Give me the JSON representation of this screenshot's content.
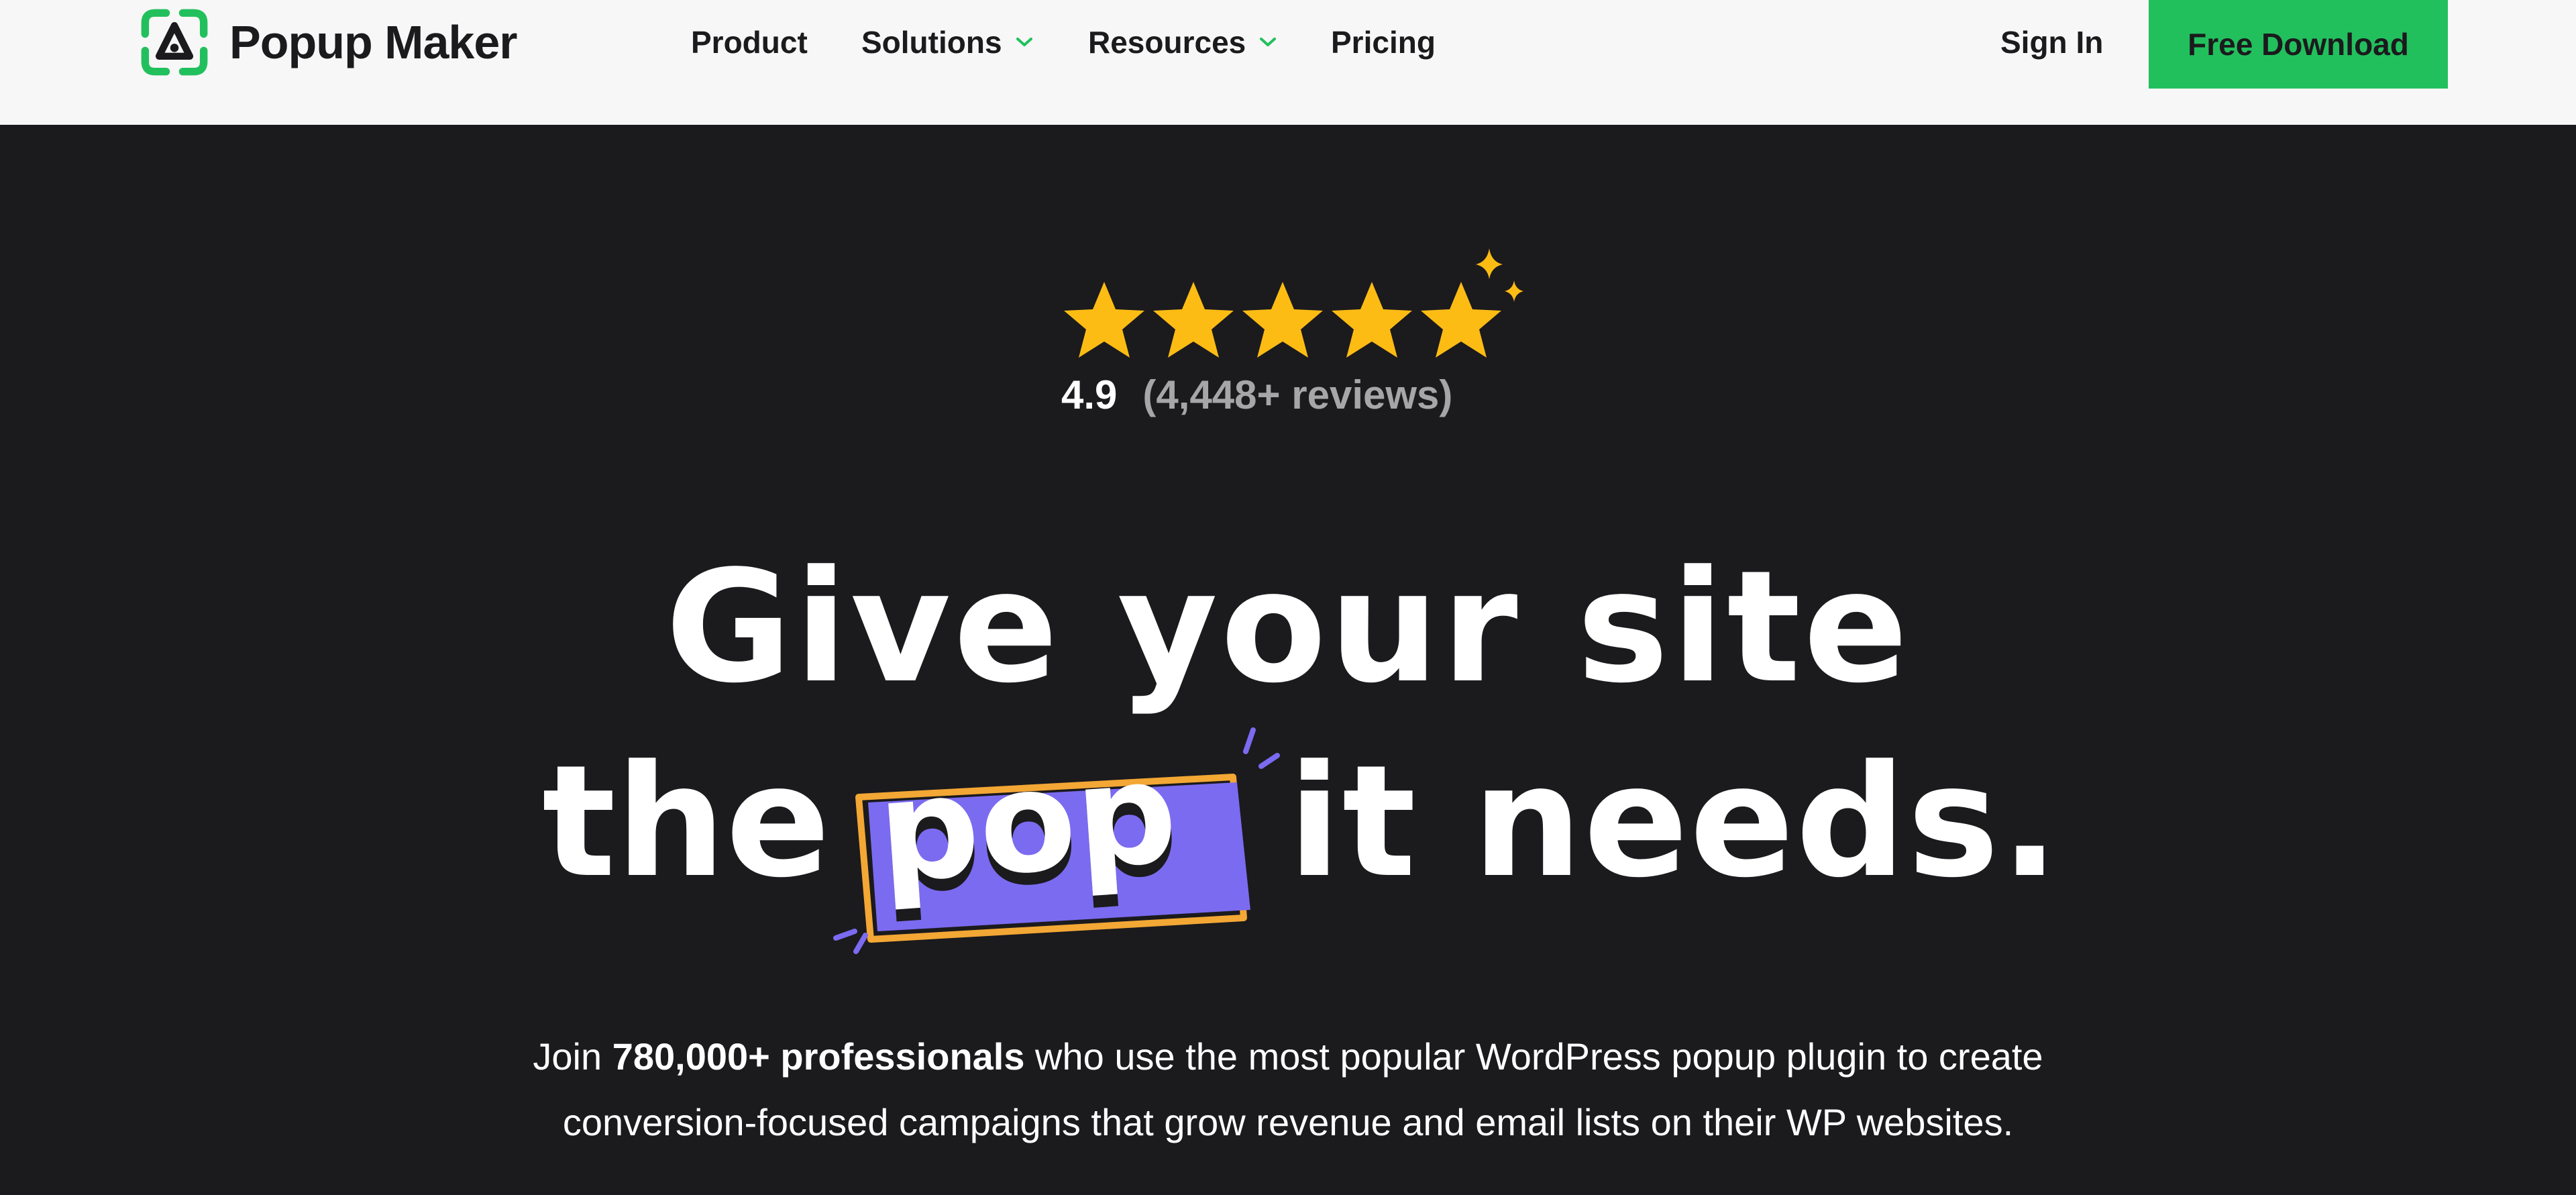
{
  "header": {
    "logo_text": "Popup Maker",
    "nav": [
      {
        "label": "Product",
        "has_dropdown": false
      },
      {
        "label": "Solutions",
        "has_dropdown": true
      },
      {
        "label": "Resources",
        "has_dropdown": true
      },
      {
        "label": "Pricing",
        "has_dropdown": false
      }
    ],
    "sign_in_label": "Sign In",
    "cta_label": "Free Download"
  },
  "hero": {
    "rating_score": "4.9",
    "rating_count": "(4,448+ reviews)",
    "star_count": 5,
    "headline_line1": "Give your site",
    "headline_the": "the",
    "headline_pop": "pop",
    "headline_rest": "it needs.",
    "subcopy_prefix": "Join ",
    "subcopy_bold": "780,000+ professionals",
    "subcopy_line1_rest": " who use the most popular WordPress popup plugin to create",
    "subcopy_line2": "conversion-focused campaigns that grow revenue and email lists on their WP websites."
  },
  "colors": {
    "brand_green": "#22c05d",
    "header_bg": "#f7f7f7",
    "hero_bg": "#1b1a1d",
    "star_yellow": "#fdbc14",
    "pop_purple": "#7b6bf0",
    "pop_orange": "#f3a734",
    "text_muted": "#a6a6a8"
  },
  "icons": {
    "logo": "popup-maker-logo-icon",
    "dropdown": "chevron-down-icon",
    "star": "star-icon",
    "sparkle": "sparkle-icon"
  }
}
